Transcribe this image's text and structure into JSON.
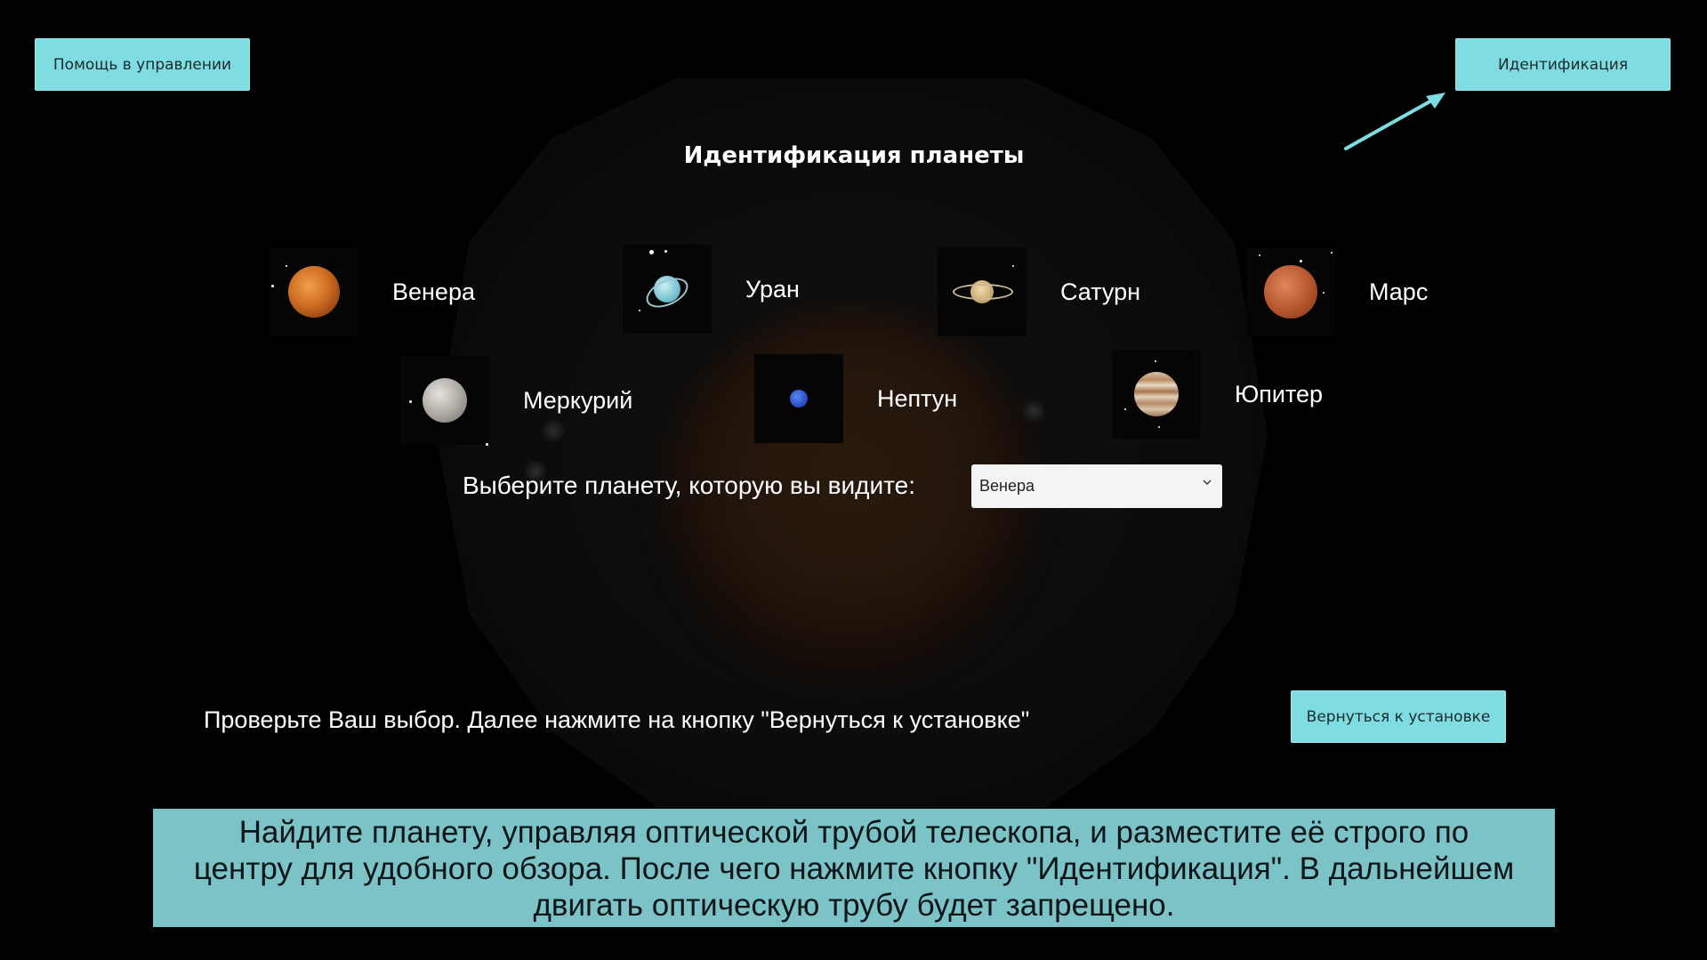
{
  "buttons": {
    "help": "Помощь в управлении",
    "identify": "Идентификация",
    "return": "Вернуться к установке"
  },
  "panel": {
    "title": "Идентификация планеты",
    "planets": [
      {
        "name": "Венера",
        "icon": "venus-icon"
      },
      {
        "name": "Уран",
        "icon": "uranus-icon"
      },
      {
        "name": "Сатурн",
        "icon": "saturn-icon"
      },
      {
        "name": "Марс",
        "icon": "mars-icon"
      },
      {
        "name": "Меркурий",
        "icon": "mercury-icon"
      },
      {
        "name": "Нептун",
        "icon": "neptune-icon"
      },
      {
        "name": "Юпитер",
        "icon": "jupiter-icon"
      }
    ],
    "select_label": "Выберите планету, которую вы видите:",
    "select_value": "Венера",
    "check_text": "Проверьте Ваш выбор. Далее нажмите на кнопку \"Вернуться к установке\""
  },
  "instruction": "Найдите планету, управляя оптической трубой телескопа, и разместите её строго по центру для удобного обзора. После чего нажмите кнопку \"Идентификация\". В дальнейшем двигать оптическую трубу будет запрещено.",
  "colors": {
    "button_bg": "#7fdde2",
    "instruction_bg": "#7cc3c8",
    "arrow": "#7fdde2"
  }
}
